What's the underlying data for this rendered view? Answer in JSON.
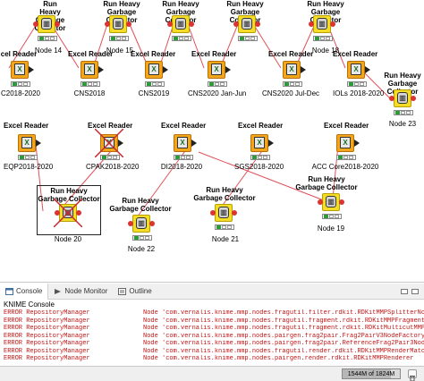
{
  "canvas": {
    "nodes": [
      {
        "id": "gc-a",
        "kind": "gc",
        "title": "Run Heavy Garbage Collector",
        "name": "Node 14",
        "crossed": false
      },
      {
        "id": "gc-b",
        "kind": "gc",
        "title": "Run Heavy Garbage Collector",
        "name": "Node 15",
        "crossed": false
      },
      {
        "id": "gc-c",
        "kind": "gc",
        "title": "Run Heavy Garbage Collector",
        "name": "",
        "crossed": false
      },
      {
        "id": "gc-d",
        "kind": "gc",
        "title": "Run Heavy Garbage Collector",
        "name": "",
        "crossed": false
      },
      {
        "id": "gc-e",
        "kind": "gc",
        "title": "Run Heavy Garbage Collector",
        "name": "Node 18",
        "crossed": false
      },
      {
        "id": "gc-f",
        "kind": "gc",
        "title": "Run Heavy Garbage Collector",
        "name": "Node 23",
        "crossed": false
      },
      {
        "id": "xl-1",
        "kind": "excel",
        "title": "cel Reader",
        "name": "C2018-2020",
        "crossed": false
      },
      {
        "id": "xl-2",
        "kind": "excel",
        "title": "Excel Reader",
        "name": "CNS2018",
        "crossed": false
      },
      {
        "id": "xl-3",
        "kind": "excel",
        "title": "Excel Reader",
        "name": "CNS2019",
        "crossed": false
      },
      {
        "id": "xl-4",
        "kind": "excel",
        "title": "Excel Reader",
        "name": "CNS2020 Jan-Jun",
        "crossed": false
      },
      {
        "id": "xl-5",
        "kind": "excel",
        "title": "Excel Reader",
        "name": "CNS2020 Jul-Dec",
        "crossed": false
      },
      {
        "id": "xl-6",
        "kind": "excel",
        "title": "Excel Reader",
        "name": "IOLs 2018-2020",
        "crossed": false
      },
      {
        "id": "xl-7",
        "kind": "excel",
        "title": "Excel Reader",
        "name": "EQP2018-2020",
        "crossed": false
      },
      {
        "id": "xl-8",
        "kind": "excel",
        "title": "Excel Reader",
        "name": "CPAK2018-2020",
        "crossed": true
      },
      {
        "id": "xl-9",
        "kind": "excel",
        "title": "Excel Reader",
        "name": "DI2018-2020",
        "crossed": false
      },
      {
        "id": "xl-10",
        "kind": "excel",
        "title": "Excel Reader",
        "name": "SGS2018-2020",
        "crossed": false
      },
      {
        "id": "xl-11",
        "kind": "excel",
        "title": "Excel Reader",
        "name": "ACC Core2018-2020",
        "crossed": false
      },
      {
        "id": "gc-20",
        "kind": "gc",
        "title": "Run Heavy Garbage Collector",
        "name": "Node 20",
        "crossed": true
      },
      {
        "id": "gc-22",
        "kind": "gc",
        "title": "Run Heavy Garbage Collector",
        "name": "Node 22",
        "crossed": false
      },
      {
        "id": "gc-21",
        "kind": "gc",
        "title": "Run Heavy Garbage Collector",
        "name": "Node 21",
        "crossed": false
      },
      {
        "id": "gc-19",
        "kind": "gc",
        "title": "Run Heavy Garbage Collector",
        "name": "Node 19",
        "crossed": false
      }
    ]
  },
  "panel": {
    "tabs": [
      {
        "label": "Console",
        "icon": "console-icon",
        "active": true
      },
      {
        "label": "Node Monitor",
        "icon": "node-monitor-icon",
        "active": false
      },
      {
        "label": "Outline",
        "icon": "outline-icon",
        "active": false
      }
    ],
    "console_title": "KNIME Console",
    "log": [
      {
        "level": "ERROR RepositoryManager",
        "message": "Node 'com.vernalis.knime.mmp.nodes.fragutil.filter.rdkit.RDKitMMPSplitterNo"
      },
      {
        "level": "ERROR RepositoryManager",
        "message": "Node 'com.vernalis.knime.mmp.nodes.fragutil.fragment.rdkit.RDKitMMPFragment3"
      },
      {
        "level": "ERROR RepositoryManager",
        "message": "Node 'com.vernalis.knime.mmp.nodes.fragutil.fragment.rdkit.RDKitMulticutMMPFrag"
      },
      {
        "level": "ERROR RepositoryManager",
        "message": "Node 'com.vernalis.knime.mmp.nodes.pairgen.frag2pair.Frag2PairV3NodeFactory"
      },
      {
        "level": "ERROR RepositoryManager",
        "message": "Node 'com.vernalis.knime.mmp.nodes.pairgen.frag2pair.ReferenceFrag2Pair3Node"
      },
      {
        "level": "ERROR RepositoryManager",
        "message": "Node 'com.vernalis.knime.mmp.nodes.fragutil.render.rdkit.RDKitMMPRenderMatc"
      },
      {
        "level": "ERROR RepositoryManager",
        "message": "Node 'com.vernalis.knime.mmp.nodes.pairgen.render.rdkit.RDKitMMPRenderer"
      }
    ]
  },
  "statusbar": {
    "heap_label": "1544M of 1824M",
    "heap_fraction": 0.846,
    "gc_icon": "trash-icon"
  },
  "colors": {
    "excel_node": "#f2a61a",
    "gc_node": "#f5dc27",
    "edge": "#e0505a",
    "error_text": "#c01515"
  }
}
